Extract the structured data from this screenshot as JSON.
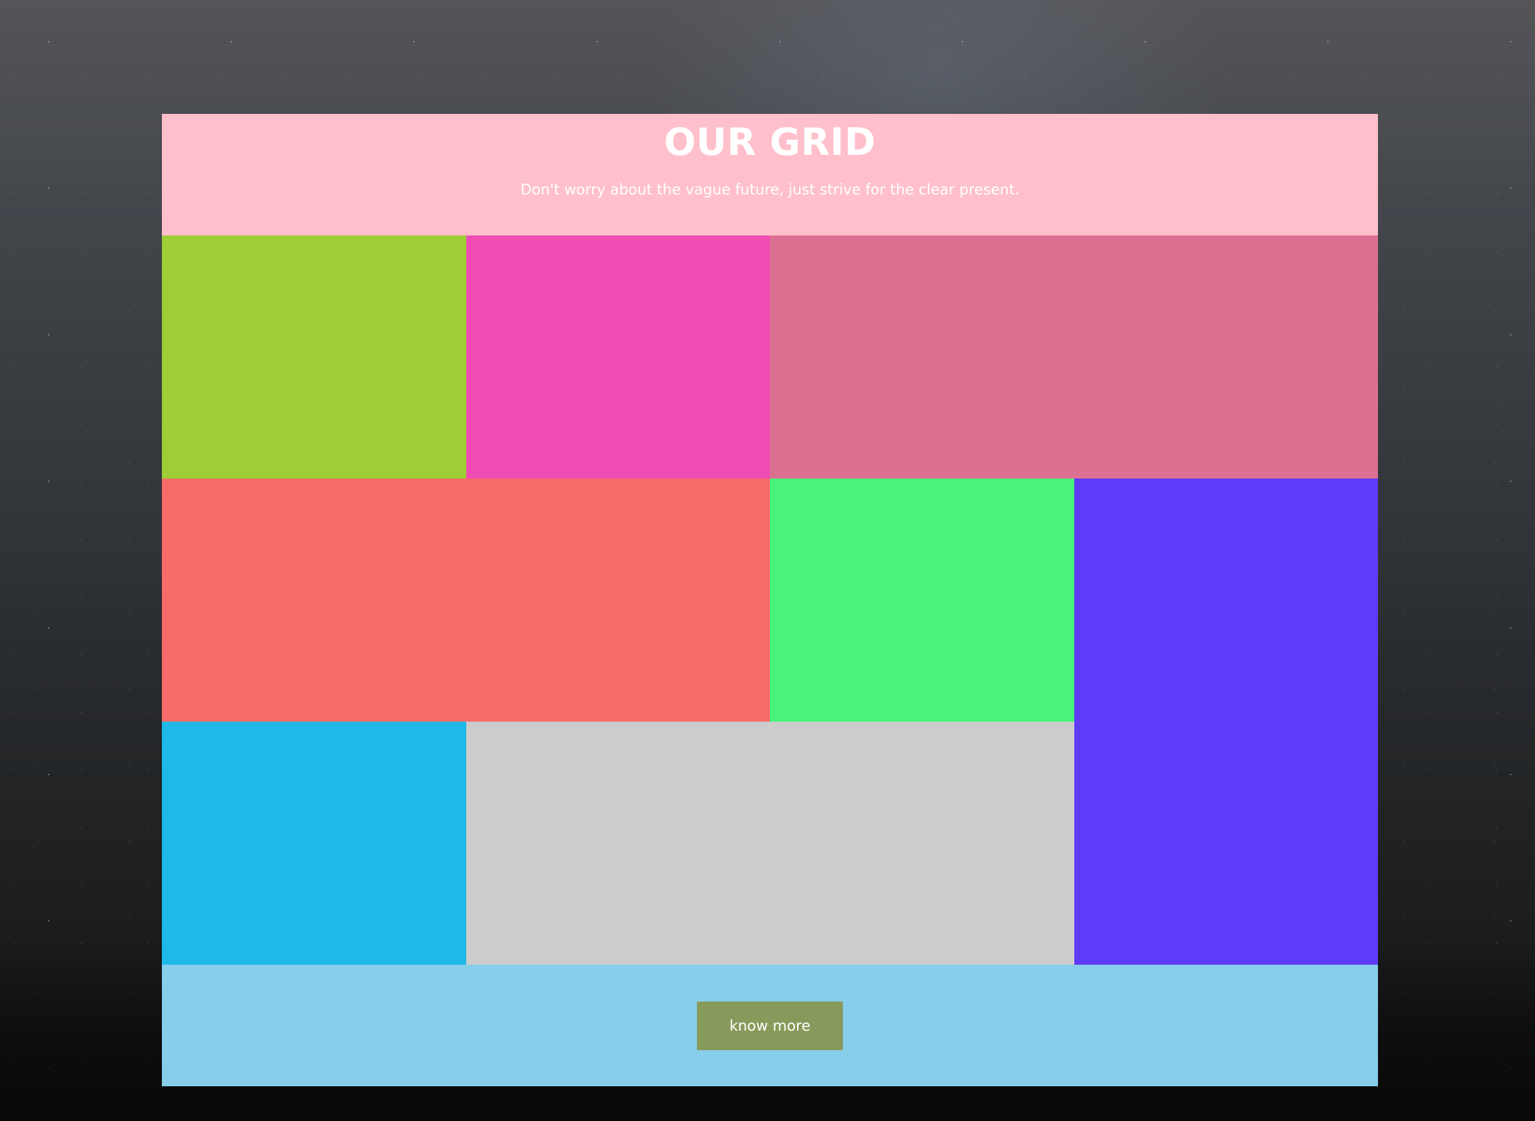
{
  "header": {
    "title": "OUR GRID",
    "subtitle": "Don't worry about the vague future, just strive for the clear present."
  },
  "grid": {
    "tiles": [
      {
        "color": "#9dce35"
      },
      {
        "color": "#f04db4"
      },
      {
        "color": "#dc7091"
      },
      {
        "color": "#f76b69"
      },
      {
        "color": "#48f27b"
      },
      {
        "color": "#5f3af8"
      },
      {
        "color": "#1fb9e9"
      },
      {
        "color": "#cccccc"
      }
    ]
  },
  "footer": {
    "button_label": "know more"
  },
  "colors": {
    "header_bg": "#ffc0cb",
    "footer_bg": "#87ceeb",
    "button_bg": "#889a5b"
  }
}
